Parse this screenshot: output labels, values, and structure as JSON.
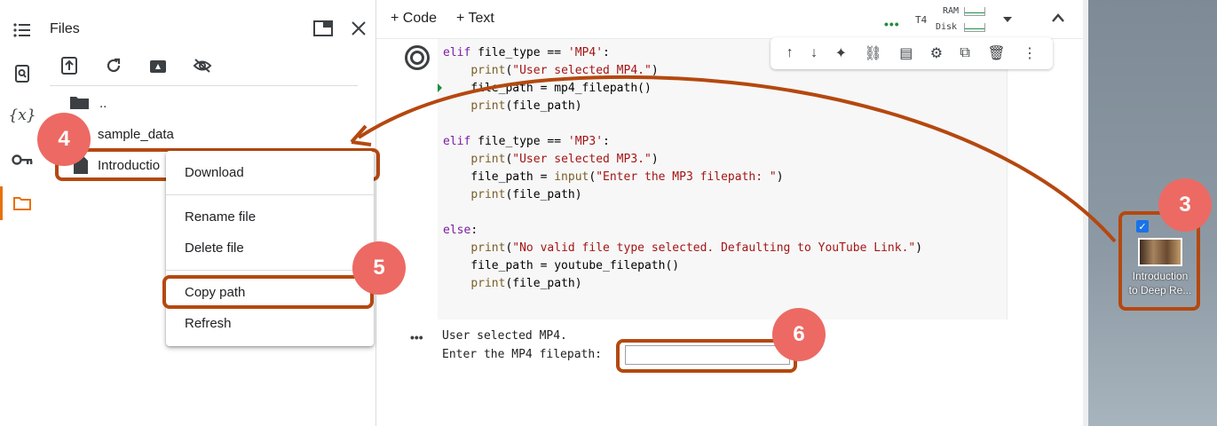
{
  "rail": {
    "icons": [
      "list-icon",
      "search-doc-icon",
      "variables-icon",
      "key-icon",
      "folder-icon"
    ],
    "variables_text": "{x}"
  },
  "files_panel": {
    "title": "Files",
    "tree": {
      "parent": "..",
      "items": [
        "sample_data",
        "Introductio"
      ]
    }
  },
  "context_menu": {
    "items": [
      "Download",
      "Rename file",
      "Delete file",
      "Copy path",
      "Refresh"
    ]
  },
  "toolbar": {
    "add_code": "+ Code",
    "add_text": "+ Text",
    "runtime": "T4",
    "ram": "RAM",
    "disk": "Disk"
  },
  "code": {
    "lines": [
      "elif file_type == 'MP4':",
      "    print(\"User selected MP4.\")",
      "    file_path = mp4_filepath()",
      "    print(file_path)",
      "",
      "elif file_type == 'MP3':",
      "    print(\"User selected MP3.\")",
      "    file_path = input(\"Enter the MP3 filepath: \")",
      "    print(file_path)",
      "",
      "else:",
      "    print(\"No valid file type selected. Defaulting to YouTube Link.\")",
      "    file_path = youtube_filepath()",
      "    print(file_path)"
    ]
  },
  "output": {
    "line1": "User selected MP4.",
    "prompt": "Enter the MP4 filepath:",
    "input_value": ""
  },
  "annotations": {
    "badges": [
      "3",
      "4",
      "5",
      "6"
    ]
  },
  "desktop": {
    "file_label_1": "Introduction",
    "file_label_2": "to Deep Re..."
  },
  "colors": {
    "highlight": "#b5480f",
    "badge": "#ec6a63",
    "accent": "#e8710a"
  }
}
